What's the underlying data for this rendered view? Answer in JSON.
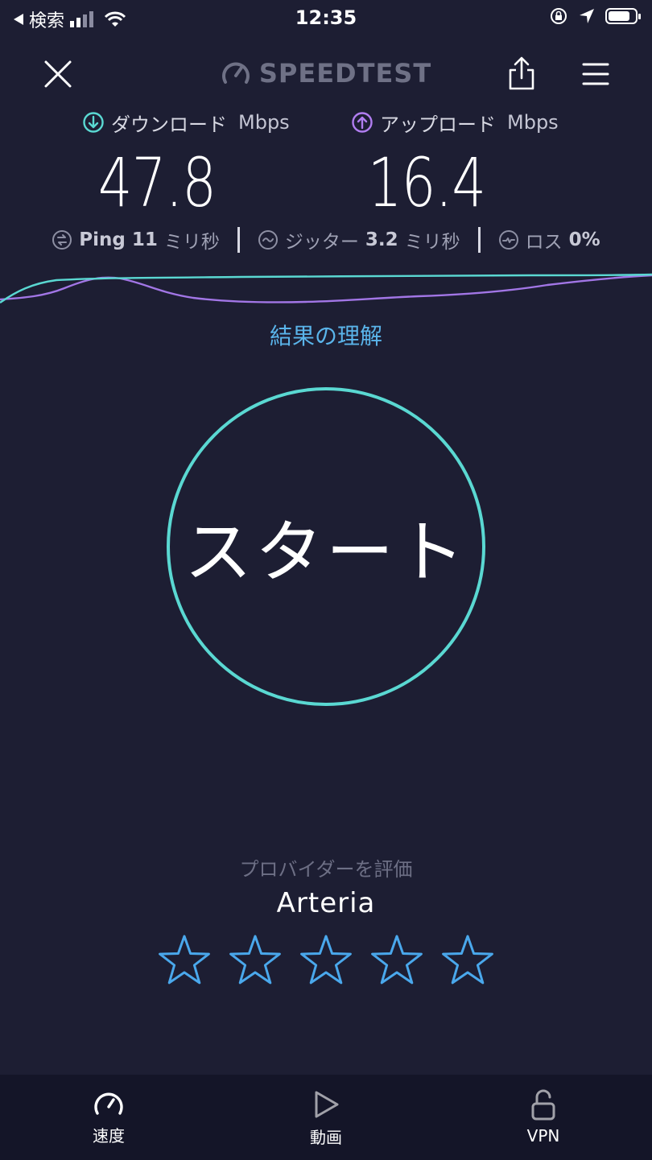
{
  "status_bar": {
    "back_label": "検索",
    "time": "12:35"
  },
  "header": {
    "brand": "SPEEDTEST",
    "close_icon": "close-icon",
    "share_icon": "share-icon",
    "menu_icon": "menu-icon"
  },
  "results": {
    "download": {
      "label": "ダウンロード",
      "unit": "Mbps",
      "value": "47.8",
      "color": "#5ad8d2"
    },
    "upload": {
      "label": "アップロード",
      "unit": "Mbps",
      "value": "16.4",
      "color": "#b07df0"
    }
  },
  "stats": {
    "ping": {
      "label": "Ping",
      "value": "11",
      "unit": "ミリ秒"
    },
    "jitter": {
      "label": "ジッター",
      "value": "3.2",
      "unit": "ミリ秒"
    },
    "loss": {
      "label": "ロス",
      "value": "0%"
    }
  },
  "understand_link": "結果の理解",
  "start_button": "スタート",
  "rating": {
    "prompt": "プロバイダーを評価",
    "provider": "Arteria",
    "stars": 5,
    "star_color": "#4aa8ec"
  },
  "tabs": [
    {
      "label": "速度",
      "icon": "gauge-icon"
    },
    {
      "label": "動画",
      "icon": "play-icon"
    },
    {
      "label": "VPN",
      "icon": "lock-icon"
    }
  ],
  "colors": {
    "background": "#1d1e33",
    "accent_teal": "#5ad8d2",
    "accent_purple": "#b07df0",
    "link_blue": "#5ab4ea"
  }
}
